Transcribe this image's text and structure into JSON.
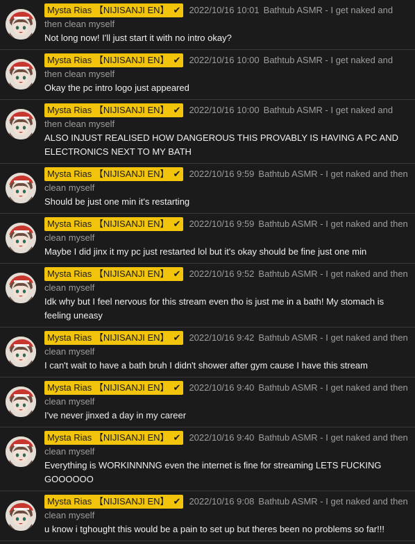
{
  "author_name": "Mysta Rias 【NIJISANJI EN】",
  "verified_icon": "checkmark-icon",
  "colors": {
    "background": "#1b1b1b",
    "author_badge": "#f2c40c",
    "divider": "#3a3a3a"
  },
  "messages": [
    {
      "timestamp": "2022/10/16 10:01",
      "video_title": "Bathtub ASMR - I get naked and then clean myself",
      "text": "Not long now! I'll just start it with no intro okay?"
    },
    {
      "timestamp": "2022/10/16 10:00",
      "video_title": "Bathtub ASMR - I get naked and then clean myself",
      "text": "Okay the pc intro logo just appeared"
    },
    {
      "timestamp": "2022/10/16 10:00",
      "video_title": "Bathtub ASMR - I get naked and then clean myself",
      "text": "ALSO INJUST REALISED HOW DANGEROUS THIS PROVABLY IS HAVING A PC AND ELECTRONICS NEXT TO MY BATH"
    },
    {
      "timestamp": "2022/10/16 9:59",
      "video_title": "Bathtub ASMR - I get naked and then clean myself",
      "text": "Should be just one min it's restarting"
    },
    {
      "timestamp": "2022/10/16 9:59",
      "video_title": "Bathtub ASMR - I get naked and then clean myself",
      "text": "Maybe I did jinx it my pc just restarted lol but it's okay should be fine just one min"
    },
    {
      "timestamp": "2022/10/16 9:52",
      "video_title": "Bathtub ASMR - I get naked and then clean myself",
      "text": "Idk why but I feel nervous for this stream even tho is just me in a bath! My stomach is feeling uneasy"
    },
    {
      "timestamp": "2022/10/16 9:42",
      "video_title": "Bathtub ASMR - I get naked and then clean myself",
      "text": "I can't wait to have a bath bruh I didn't shower after gym cause I have this stream"
    },
    {
      "timestamp": "2022/10/16 9:40",
      "video_title": "Bathtub ASMR - I get naked and then clean myself",
      "text": "I've never jinxed a day in my career"
    },
    {
      "timestamp": "2022/10/16 9:40",
      "video_title": "Bathtub ASMR - I get naked and then clean myself",
      "text": "Everything is WORKINNNNG even the internet is fine for streaming LETS FUCKING GOOOOOO"
    },
    {
      "timestamp": "2022/10/16 9:08",
      "video_title": "Bathtub ASMR - I get naked and then clean myself",
      "text": "u know i tghought this would be a pain to set up but theres been no problems so far!!!"
    }
  ]
}
